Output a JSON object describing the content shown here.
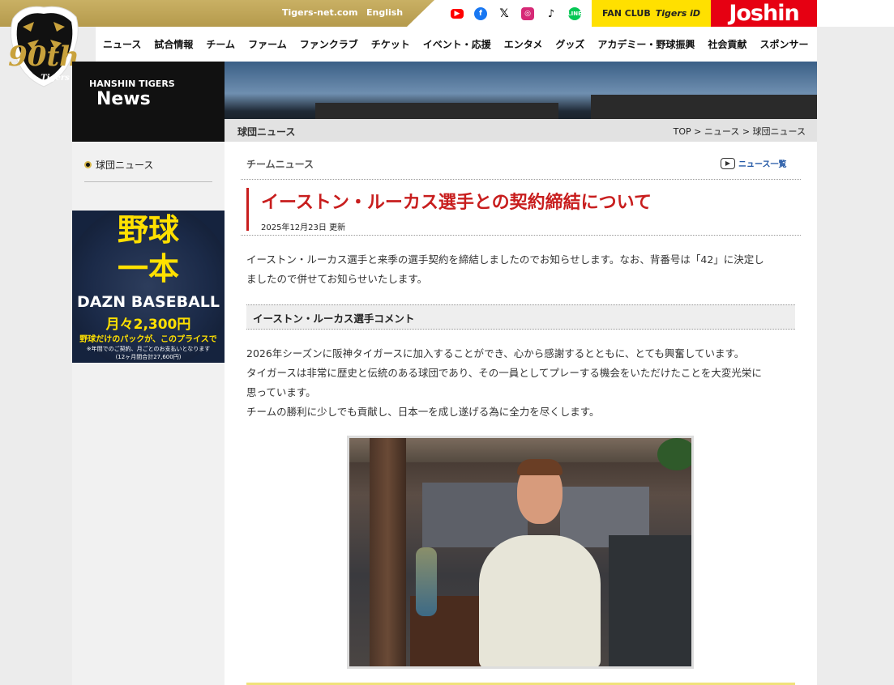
{
  "topbar": {
    "links": [
      "Tigers-net.com",
      "English"
    ],
    "sns": [
      {
        "icon": "youtube-icon",
        "color": "#ff0000"
      },
      {
        "icon": "facebook-icon",
        "color": "#1877f2"
      },
      {
        "icon": "x-icon",
        "color": "#000000"
      },
      {
        "icon": "instagram-icon",
        "color": "#d62976"
      },
      {
        "icon": "tiktok-icon",
        "color": "#000000"
      },
      {
        "icon": "line-icon",
        "color": "#06c755"
      }
    ],
    "fanclub_label": "FAN CLUB",
    "tigers_id_label": "Tigers iD",
    "joshin_label": "Joshin"
  },
  "logo": {
    "text_90th": "90th",
    "text_tigers": "Tigers"
  },
  "nav": {
    "items": [
      "ニュース",
      "試合情報",
      "チーム",
      "ファーム",
      "ファンクラブ",
      "チケット",
      "イベント・応援",
      "エンタメ",
      "グッズ",
      "アカデミー・野球振興",
      "社会貢献",
      "スポンサー"
    ]
  },
  "banner": {
    "line1": "HANSHIN TIGERS",
    "line2": "News"
  },
  "crumbbar": {
    "section": "球団ニュース",
    "breadcrumb": "TOP > ニュース > 球団ニュース"
  },
  "sidebar": {
    "item": "球団ニュース",
    "ad": {
      "line1": "野球",
      "line2": "一本",
      "line3": "DAZN BASEBALL",
      "line4": "月々2,300円",
      "line5": "野球だけのパックが、このプライスで",
      "line6": "※年間でのご契約、月ごとのお支払いとなります",
      "line7": "(12ヶ月間合計27,600円)"
    }
  },
  "main": {
    "category": "チームニュース",
    "list_link": "ニュース一覧",
    "title": "イーストン・ルーカス選手との契約締結について",
    "date": "2025年12月23日 更新",
    "intro_1": "イーストン・ルーカス選手と来季の選手契約を締結しましたのでお知らせします。なお、背番号は「42」に決定し",
    "intro_2": "ましたので併せてお知らせいたします。",
    "subhead": "イーストン・ルーカス選手コメント",
    "comment_1": "2026年シーズンに阪神タイガースに加入することができ、心から感謝するとともに、とても興奮しています。",
    "comment_2": "タイガースは非常に歴史と伝統のある球団であり、その一員としてプレーする機会をいただけたことを大変光栄に",
    "comment_3": "思っています。",
    "comment_4": "チームの勝利に少しでも貢献し、日本一を成し遂げる為に全力を尽くします。"
  }
}
